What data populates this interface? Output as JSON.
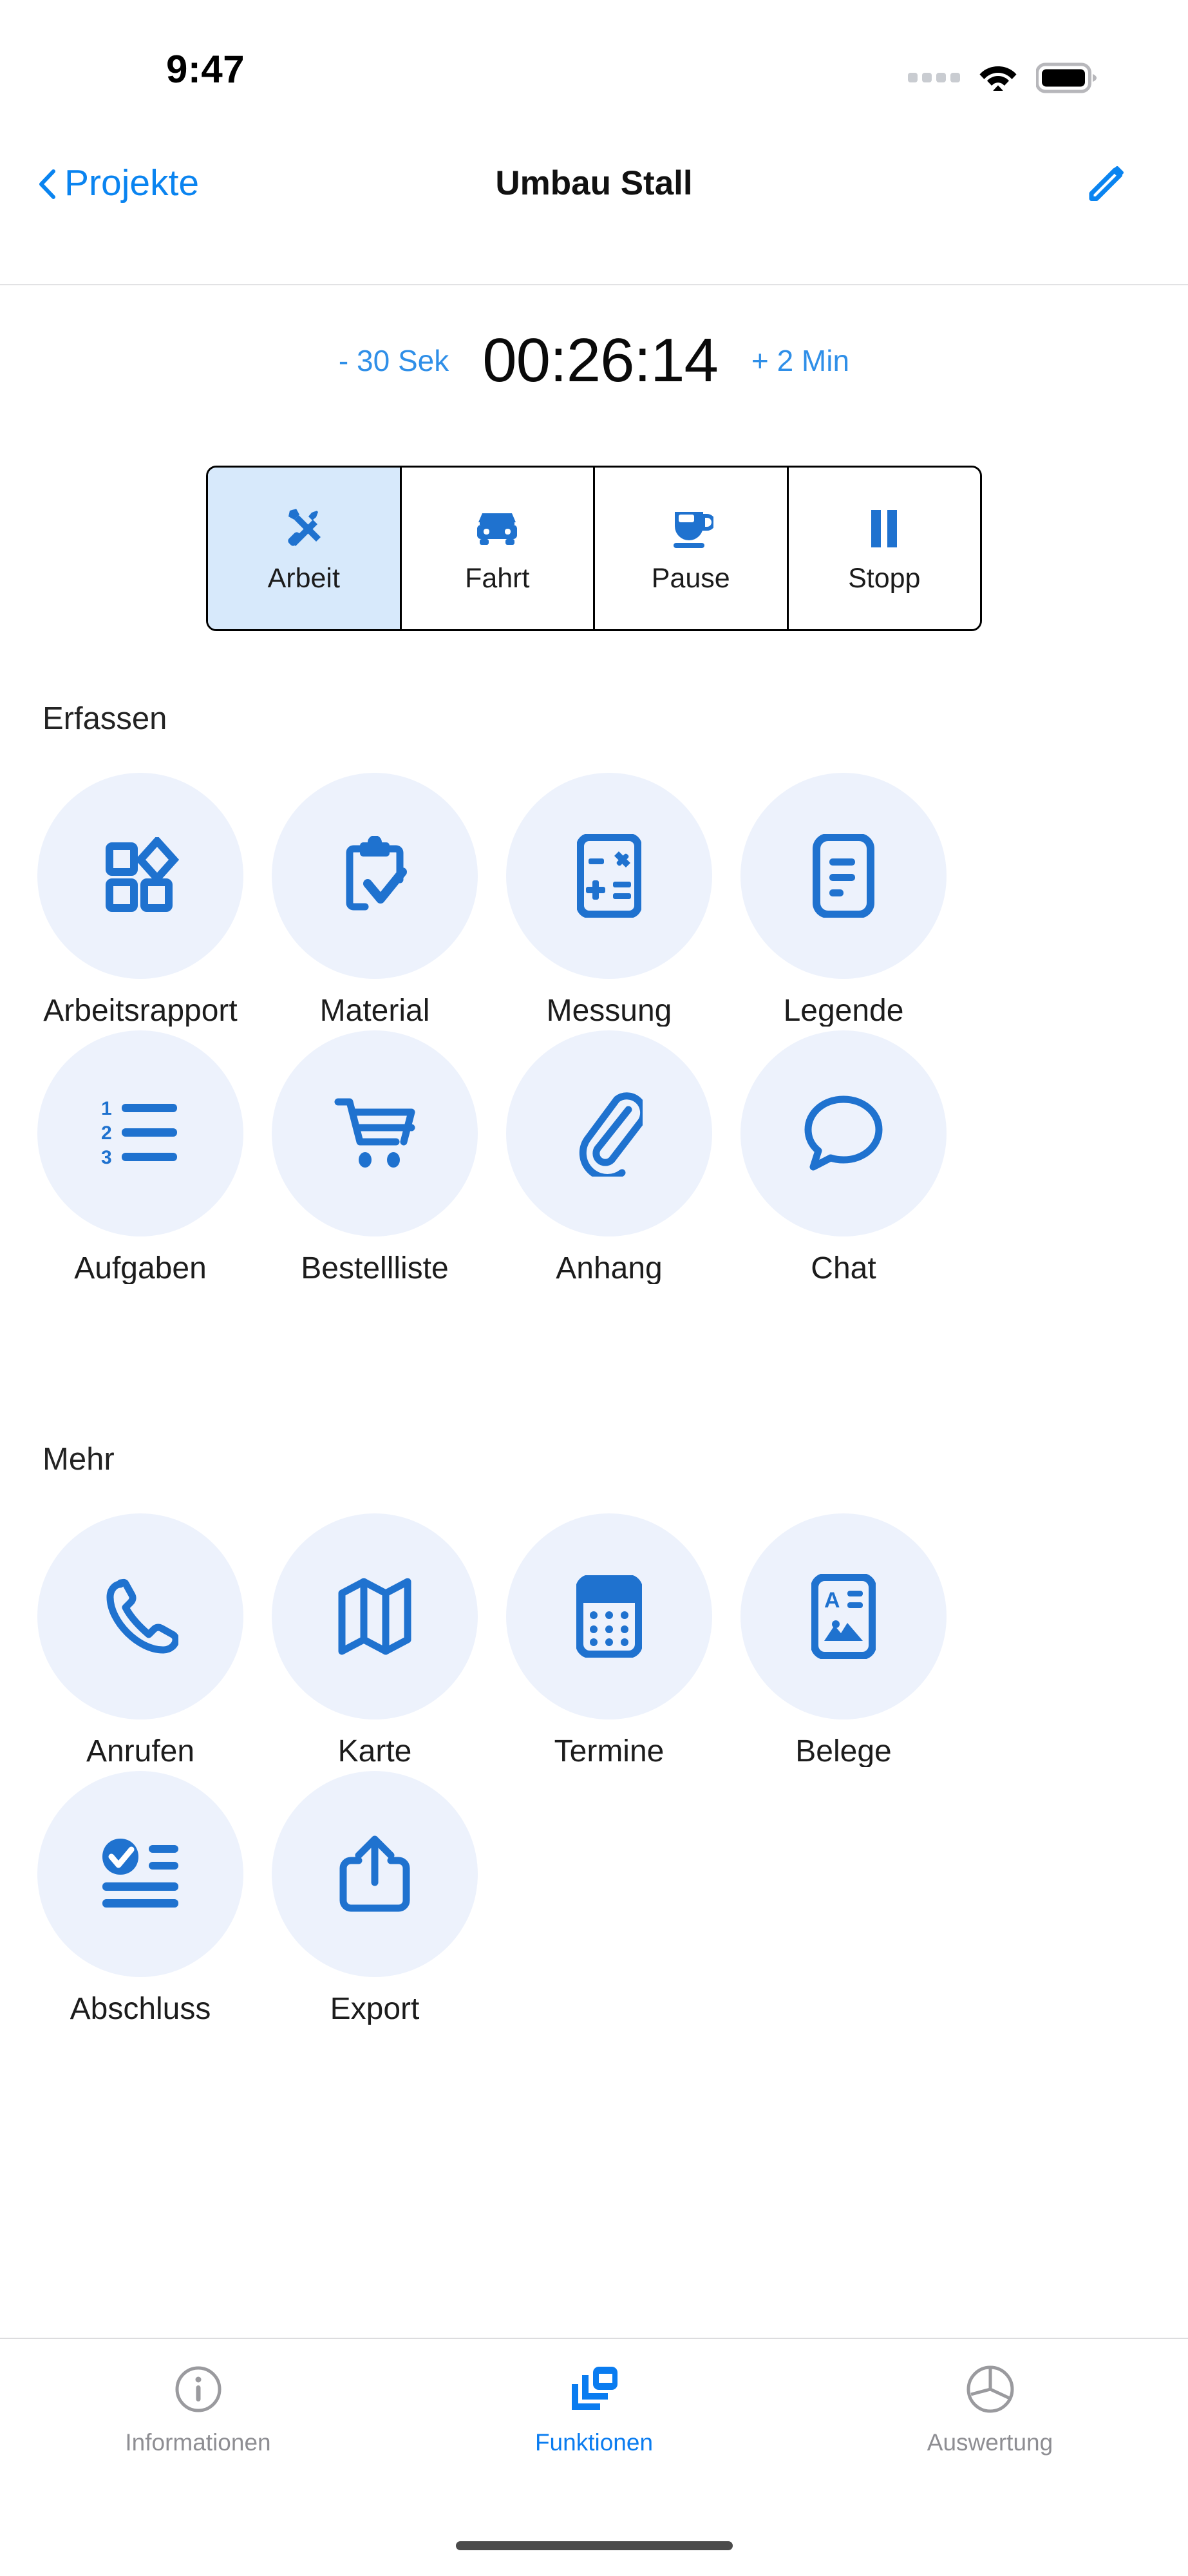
{
  "status_bar": {
    "time": "9:47",
    "signal_icon": "signal-dots-icon",
    "wifi_icon": "wifi-icon",
    "battery_icon": "battery-full-icon"
  },
  "nav": {
    "back_label": "Projekte",
    "back_icon": "chevron-left-icon",
    "title": "Umbau Stall",
    "edit_icon": "pencil-icon"
  },
  "timer": {
    "decrement_label": "- 30 Sek",
    "value": "00:26:14",
    "increment_label": "+ 2 Min"
  },
  "mode_segments": [
    {
      "label": "Arbeit",
      "icon": "tools-hammer-wrench-icon",
      "active": true
    },
    {
      "label": "Fahrt",
      "icon": "car-icon",
      "active": false
    },
    {
      "label": "Pause",
      "icon": "coffee-cup-icon",
      "active": false
    },
    {
      "label": "Stopp",
      "icon": "pause-icon",
      "active": false
    }
  ],
  "sections": [
    {
      "title": "Erfassen",
      "tiles": [
        {
          "label": "Arbeitsrapport",
          "icon": "shapes-grid-icon"
        },
        {
          "label": "Material",
          "icon": "clipboard-check-icon"
        },
        {
          "label": "Messung",
          "icon": "calculator-icon"
        },
        {
          "label": "Legende",
          "icon": "document-lines-icon"
        },
        {
          "label": "Aufgaben",
          "icon": "numbered-list-icon"
        },
        {
          "label": "Bestellliste",
          "icon": "shopping-cart-icon"
        },
        {
          "label": "Anhang",
          "icon": "paperclip-icon"
        },
        {
          "label": "Chat",
          "icon": "speech-bubble-icon"
        }
      ]
    },
    {
      "title": "Mehr",
      "tiles": [
        {
          "label": "Anrufen",
          "icon": "phone-icon"
        },
        {
          "label": "Karte",
          "icon": "map-icon"
        },
        {
          "label": "Termine",
          "icon": "calendar-icon"
        },
        {
          "label": "Belege",
          "icon": "receipt-card-icon"
        },
        {
          "label": "Abschluss",
          "icon": "checklist-done-icon"
        },
        {
          "label": "Export",
          "icon": "share-export-icon"
        }
      ]
    }
  ],
  "tabs": [
    {
      "label": "Informationen",
      "icon": "info-circle-icon",
      "active": false
    },
    {
      "label": "Funktionen",
      "icon": "stacked-cards-icon",
      "active": true
    },
    {
      "label": "Auswertung",
      "icon": "pie-chart-icon",
      "active": false
    }
  ],
  "colors": {
    "accent": "#0a7cf0",
    "tile_bg": "#edf2fc",
    "icon_blue": "#1f72cf",
    "segment_active_bg": "#d7e9fb",
    "inactive_gray": "#8e8e93"
  }
}
